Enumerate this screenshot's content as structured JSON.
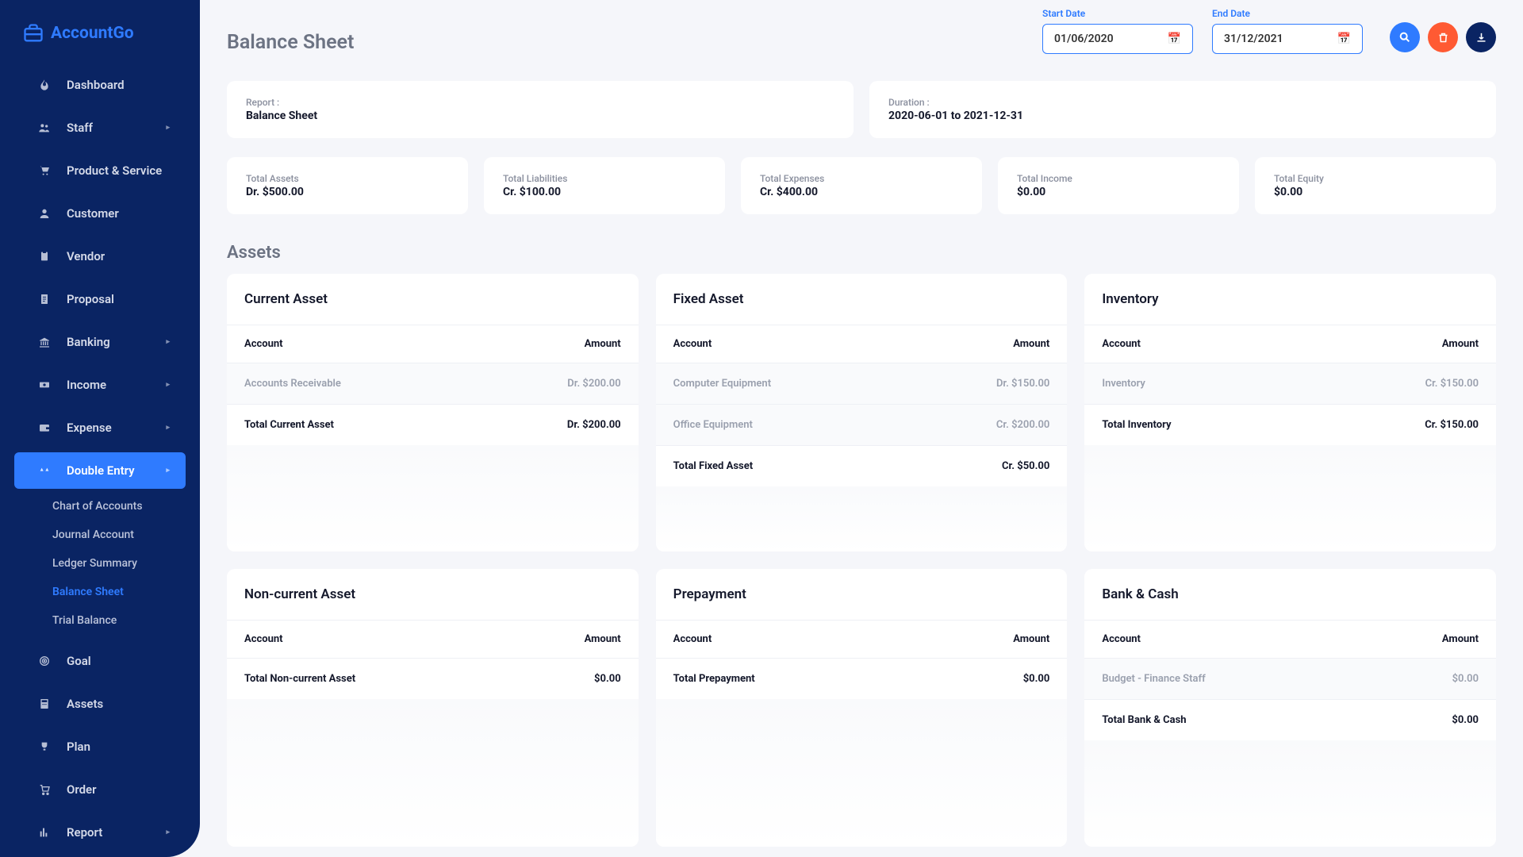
{
  "brand": "AccountGo",
  "nav": [
    {
      "label": "Dashboard",
      "icon": "flame"
    },
    {
      "label": "Staff",
      "icon": "users",
      "caret": true
    },
    {
      "label": "Product & Service",
      "icon": "cart"
    },
    {
      "label": "Customer",
      "icon": "user"
    },
    {
      "label": "Vendor",
      "icon": "clipboard"
    },
    {
      "label": "Proposal",
      "icon": "doc"
    },
    {
      "label": "Banking",
      "icon": "bank",
      "caret": true
    },
    {
      "label": "Income",
      "icon": "cash",
      "caret": true
    },
    {
      "label": "Expense",
      "icon": "wallet",
      "caret": true
    },
    {
      "label": "Double Entry",
      "icon": "scale",
      "caret": true,
      "active": true
    },
    {
      "label": "Goal",
      "icon": "target"
    },
    {
      "label": "Assets",
      "icon": "calc"
    },
    {
      "label": "Plan",
      "icon": "trophy"
    },
    {
      "label": "Order",
      "icon": "cart2"
    },
    {
      "label": "Report",
      "icon": "chart",
      "caret": true
    }
  ],
  "subnav": [
    {
      "label": "Chart of Accounts"
    },
    {
      "label": "Journal Account"
    },
    {
      "label": "Ledger Summary"
    },
    {
      "label": "Balance Sheet",
      "active": true
    },
    {
      "label": "Trial Balance"
    }
  ],
  "page": {
    "title": "Balance Sheet",
    "start_label": "Start Date",
    "end_label": "End Date",
    "start_date": "01/06/2020",
    "end_date": "31/12/2021"
  },
  "info": {
    "report_label": "Report :",
    "report_value": "Balance Sheet",
    "duration_label": "Duration :",
    "duration_value": "2020-06-01 to 2021-12-31"
  },
  "summary": [
    {
      "label": "Total Assets",
      "value": "Dr. $500.00"
    },
    {
      "label": "Total Liabilities",
      "value": "Cr. $100.00"
    },
    {
      "label": "Total Expenses",
      "value": "Cr. $400.00"
    },
    {
      "label": "Total Income",
      "value": "$0.00"
    },
    {
      "label": "Total Equity",
      "value": "$0.00"
    }
  ],
  "section_assets": "Assets",
  "col_account": "Account",
  "col_amount": "Amount",
  "asset_cards": [
    {
      "title": "Current Asset",
      "rows": [
        {
          "name": "Accounts Receivable",
          "amount": "Dr. $200.00"
        }
      ],
      "total_label": "Total Current Asset",
      "total_amount": "Dr. $200.00"
    },
    {
      "title": "Fixed Asset",
      "rows": [
        {
          "name": "Computer Equipment",
          "amount": "Dr. $150.00"
        },
        {
          "name": "Office Equipment",
          "amount": "Cr. $200.00"
        }
      ],
      "total_label": "Total Fixed Asset",
      "total_amount": "Cr. $50.00"
    },
    {
      "title": "Inventory",
      "rows": [
        {
          "name": "Inventory",
          "amount": "Cr. $150.00"
        }
      ],
      "total_label": "Total Inventory",
      "total_amount": "Cr. $150.00"
    },
    {
      "title": "Non-current Asset",
      "rows": [],
      "total_label": "Total Non-current Asset",
      "total_amount": "$0.00"
    },
    {
      "title": "Prepayment",
      "rows": [],
      "total_label": "Total Prepayment",
      "total_amount": "$0.00"
    },
    {
      "title": "Bank & Cash",
      "rows": [
        {
          "name": "Budget - Finance Staff",
          "amount": "$0.00"
        }
      ],
      "total_label": "Total Bank & Cash",
      "total_amount": "$0.00"
    }
  ]
}
